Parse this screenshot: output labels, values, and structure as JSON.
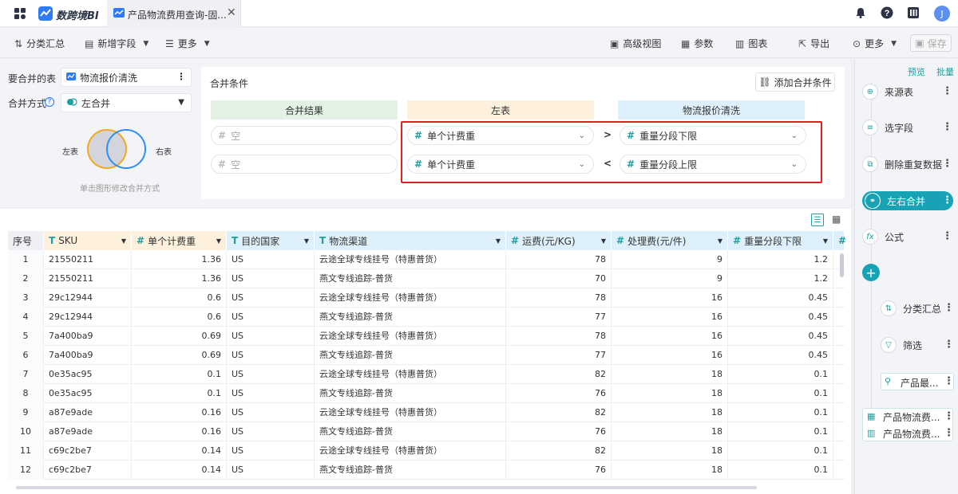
{
  "app": {
    "brand": "数跨境BI",
    "tab_title": "产品物流费用查询-固..."
  },
  "toolbar": {
    "group_summary": "分类汇总",
    "add_field": "新增字段",
    "more_left": "更多",
    "advanced_view": "高级视图",
    "params": "参数",
    "chart": "图表",
    "export": "导出",
    "more_right": "更多",
    "save": "保存"
  },
  "config": {
    "merge_table_label": "要合并的表",
    "merge_table_value": "物流报价清洗",
    "merge_mode_label": "合并方式",
    "merge_mode_value": "左合并",
    "venn_left": "左表",
    "venn_right": "右表",
    "venn_hint": "单击图形修改合并方式",
    "cond_title": "合并条件",
    "add_cond": "添加合并条件",
    "col_result": "合并结果",
    "col_left": "左表",
    "col_right": "物流报价清洗",
    "rows": [
      {
        "result": "空",
        "left": "单个计费重",
        "op": ">",
        "right": "重量分段下限"
      },
      {
        "result": "空",
        "left": "单个计费重",
        "op": "<",
        "right": "重量分段上限"
      }
    ]
  },
  "table": {
    "headers": [
      {
        "label": "序号",
        "type": ""
      },
      {
        "label": "SKU",
        "type": "T"
      },
      {
        "label": "单个计费重",
        "type": "#"
      },
      {
        "label": "目的国家",
        "type": "T"
      },
      {
        "label": "物流渠道",
        "type": "T"
      },
      {
        "label": "运费(元/KG)",
        "type": "#"
      },
      {
        "label": "处理费(元/件)",
        "type": "#"
      },
      {
        "label": "重量分段下限",
        "type": "#"
      }
    ],
    "rows": [
      [
        "1",
        "21550211",
        "1.36",
        "US",
        "云途全球专线挂号（特惠普货）",
        "78",
        "9",
        "1.2"
      ],
      [
        "2",
        "21550211",
        "1.36",
        "US",
        "燕文专线追踪-普货",
        "70",
        "9",
        "1.2"
      ],
      [
        "3",
        "29c12944",
        "0.6",
        "US",
        "云途全球专线挂号（特惠普货）",
        "78",
        "16",
        "0.45"
      ],
      [
        "4",
        "29c12944",
        "0.6",
        "US",
        "燕文专线追踪-普货",
        "77",
        "16",
        "0.45"
      ],
      [
        "5",
        "7a400ba9",
        "0.69",
        "US",
        "云途全球专线挂号（特惠普货）",
        "78",
        "16",
        "0.45"
      ],
      [
        "6",
        "7a400ba9",
        "0.69",
        "US",
        "燕文专线追踪-普货",
        "77",
        "16",
        "0.45"
      ],
      [
        "7",
        "0e35ac95",
        "0.1",
        "US",
        "云途全球专线挂号（特惠普货）",
        "82",
        "18",
        "0.1"
      ],
      [
        "8",
        "0e35ac95",
        "0.1",
        "US",
        "燕文专线追踪-普货",
        "76",
        "18",
        "0.1"
      ],
      [
        "9",
        "a87e9ade",
        "0.16",
        "US",
        "云途全球专线挂号（特惠普货）",
        "82",
        "18",
        "0.1"
      ],
      [
        "10",
        "a87e9ade",
        "0.16",
        "US",
        "燕文专线追踪-普货",
        "76",
        "18",
        "0.1"
      ],
      [
        "11",
        "c69c2be7",
        "0.14",
        "US",
        "云途全球专线挂号（特惠普货）",
        "82",
        "18",
        "0.1"
      ],
      [
        "12",
        "c69c2be7",
        "0.14",
        "US",
        "燕文专线追踪-普货",
        "76",
        "18",
        "0.1"
      ]
    ]
  },
  "pipeline": {
    "preview": "预览",
    "batch": "批量",
    "steps": [
      "来源表",
      "选字段",
      "删除重复数据",
      "左右合并",
      "公式"
    ],
    "branch": [
      "分类汇总",
      "筛选",
      "产品最..."
    ],
    "outputs": [
      "产品物流费...",
      "产品物流费..."
    ]
  },
  "colors": {
    "accent": "#1aa1a0",
    "active": "#17a3b5",
    "red": "#e02020"
  }
}
